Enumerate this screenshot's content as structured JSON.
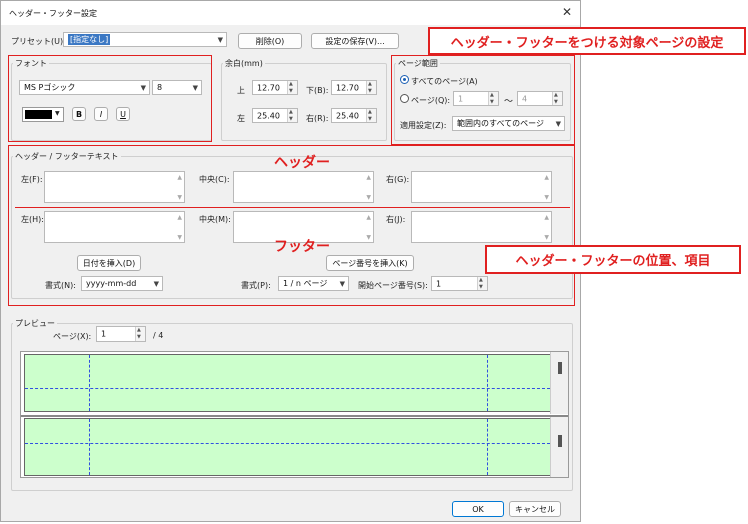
{
  "window": {
    "title": "ヘッダー・フッター設定",
    "close_label": "✕"
  },
  "preset": {
    "label": "プリセット(U):",
    "value": "[指定なし]",
    "delete_label": "削除(O)",
    "save_label": "設定の保存(V)..."
  },
  "font": {
    "group_label": "フォント",
    "family": "MS Pゴシック",
    "size": "8",
    "color": "#000000",
    "bold_label": "B",
    "italic_label": "I",
    "underline_label": "U"
  },
  "margin": {
    "group_label": "余白(mm)",
    "top_label": "上",
    "top_value": "12.70",
    "bottom_label": "下(B):",
    "bottom_value": "12.70",
    "left_label": "左",
    "left_value": "25.40",
    "right_label": "右(R):",
    "right_value": "25.40"
  },
  "page_range": {
    "group_label": "ページ範囲",
    "all_label": "すべてのページ(A)",
    "page_label": "ページ(Q):",
    "from_value": "1",
    "tilde": "～",
    "to_value": "4",
    "apply_label": "適用設定(Z):",
    "apply_value": "範囲内のすべてのページ"
  },
  "hf_text": {
    "group_label": "ヘッダー / フッターテキスト",
    "header_left_label": "左(F):",
    "header_center_label": "中央(C):",
    "header_right_label": "右(G):",
    "footer_left_label": "左(H):",
    "footer_center_label": "中央(M):",
    "footer_right_label": "右(J):",
    "insert_date_label": "日付を挿入(D)",
    "insert_page_label": "ページ番号を挿入(K)",
    "date_format_label": "書式(N):",
    "date_format_value": "yyyy-mm-dd",
    "page_format_label": "書式(P):",
    "page_format_value": "1 / n ページ",
    "start_page_label": "開始ページ番号(S):",
    "start_page_value": "1"
  },
  "preview": {
    "group_label": "プレビュー",
    "page_label": "ページ(X):",
    "page_value": "1",
    "total": "/  4"
  },
  "footer_buttons": {
    "ok_label": "OK",
    "cancel_label": "キャンセル"
  },
  "annotations": {
    "target_pages": "ヘッダー・フッターをつける対象ページの設定",
    "header": "ヘッダー",
    "footer": "フッター",
    "position_items": "ヘッダー・フッターの位置、項目"
  },
  "colors": {
    "annotation_red": "#e02020",
    "preview_page": "#ccffcc",
    "guide_blue": "#3050e0"
  }
}
